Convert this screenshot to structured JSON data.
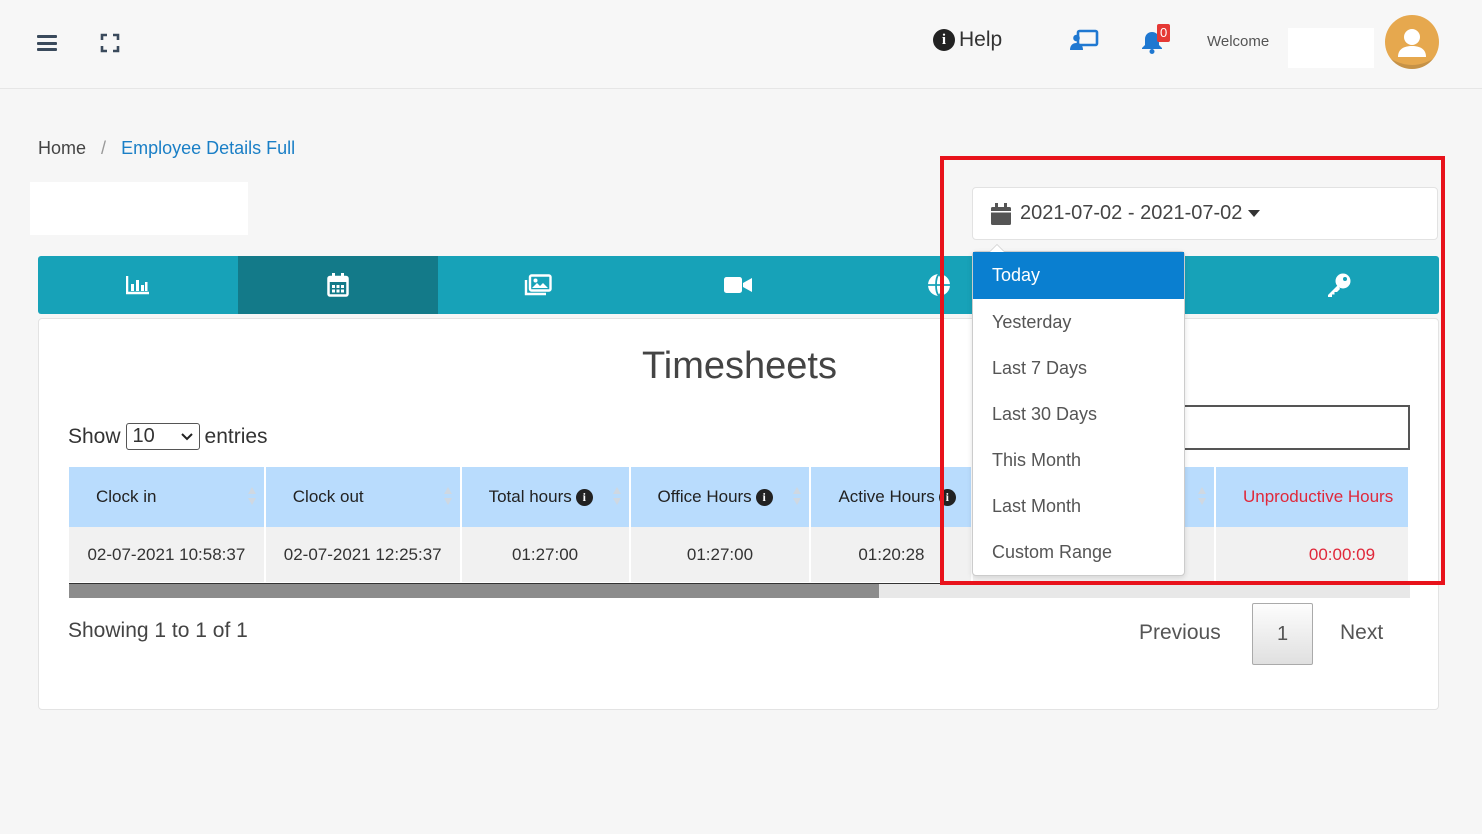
{
  "header": {
    "help_label": "Help",
    "notification_count": "0",
    "welcome_label": "Welcome"
  },
  "breadcrumb": {
    "home": "Home",
    "separator": "/",
    "current": "Employee Details Full"
  },
  "date_range": {
    "value": "2021-07-02 - 2021-07-02",
    "options": [
      "Today",
      "Yesterday",
      "Last 7 Days",
      "Last 30 Days",
      "This Month",
      "Last Month",
      "Custom Range"
    ],
    "selected": "Today"
  },
  "tabs": [
    {
      "icon": "bar-chart-icon"
    },
    {
      "icon": "calendar-icon",
      "active": true
    },
    {
      "icon": "images-icon"
    },
    {
      "icon": "video-camera-icon"
    },
    {
      "icon": "globe-icon"
    },
    {
      "icon": "tab-6"
    },
    {
      "icon": "key-icon"
    }
  ],
  "timesheets": {
    "title": "Timesheets",
    "show_label": "Show",
    "entries_value": "10",
    "entries_label": "entries",
    "columns": [
      "Clock in",
      "Clock out",
      "Total hours",
      "Office Hours",
      "Active Hours",
      "",
      "Unproductive Hours"
    ],
    "rows": [
      [
        "02-07-2021 10:58:37",
        "02-07-2021 12:25:37",
        "01:27:00",
        "01:27:00",
        "01:20:28",
        "",
        "00:00:09"
      ]
    ],
    "showing_text": "Showing 1 to 1 of 1",
    "previous_label": "Previous",
    "page": "1",
    "next_label": "Next"
  },
  "colors": {
    "teal": "#17a2b8",
    "teal_active": "#137a89",
    "header_blue": "#b9dcfd",
    "dropdown_active": "#0a7fd0",
    "highlight_red": "#e8121b",
    "unproductive_red": "#e0283a"
  }
}
